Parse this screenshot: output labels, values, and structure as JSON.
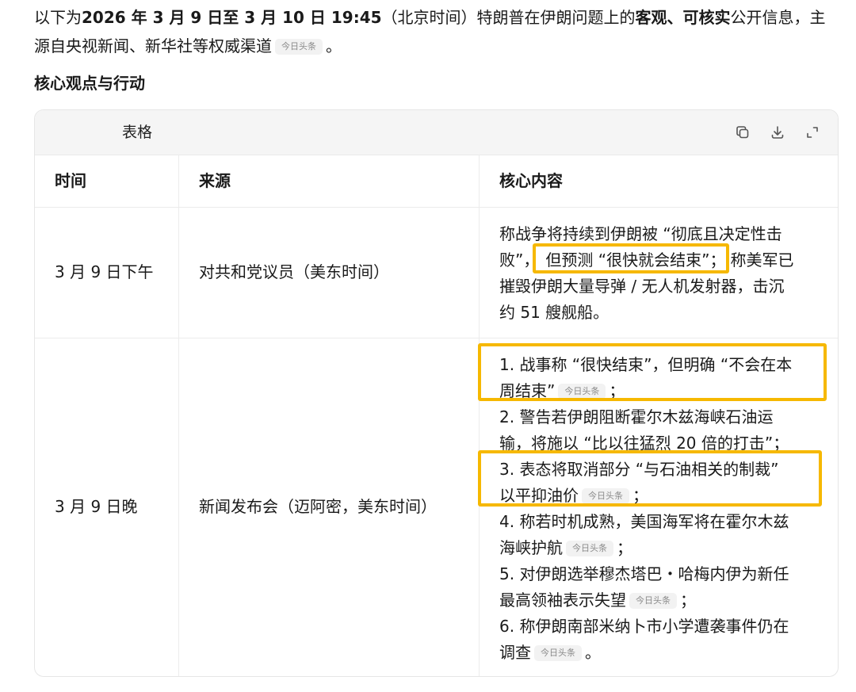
{
  "intro": {
    "l1_a": "以下为",
    "l1_b": "2026 年 3 月 9 日至 3 月 10 日 19:45",
    "l1_c": "（北京时间）特朗普在伊朗问题上的",
    "l1_d": "客观、可核实",
    "l1_e": "公开信息，主",
    "l2_a": "源自央视新闻、新华社等权威渠道",
    "l2_chip": "今日头条",
    "l2_b": "。"
  },
  "section_title": "核心观点与行动",
  "table": {
    "title": "表格",
    "icons": [
      "copy-icon",
      "download-icon",
      "expand-icon"
    ],
    "headers": {
      "time": "时间",
      "source": "来源",
      "content": "核心内容"
    },
    "rows": [
      {
        "time": "3 月 9 日下午",
        "source": "对共和党议员（美东时间）",
        "content_lines": [
          "称战争将持续到伊朗被 “彻底且决定性击",
          "败”，",
          "但预测 “很快就会结束”；",
          "称美军已",
          "摧毁伊朗大量导弹 / 无人机发射器，击沉",
          "约 51 艘舰船。"
        ]
      },
      {
        "time": "3 月 9 日晚",
        "source": "新闻发布会（迈阿密，美东时间）",
        "items": [
          {
            "l1": "1. 战事称 “很快结束”，但明确 “不会在本",
            "l2": "周结束”",
            "chip": "今日头条",
            "end": "；"
          },
          {
            "l1": "2. 警告若伊朗阻断霍尔木兹海峡石油运",
            "l2": "输，将施以 “比以往猛烈 20 倍的打击”；",
            "chip": "",
            "end": ""
          },
          {
            "l1": "3. 表态将取消部分 “与石油相关的制裁”",
            "l2": "以平抑油价",
            "chip": "今日头条",
            "end": "；"
          },
          {
            "l1": "4. 称若时机成熟，美国海军将在霍尔木兹",
            "l2": "海峡护航",
            "chip": "今日头条",
            "end": "；"
          },
          {
            "l1": "5. 对伊朗选举穆杰塔巴・哈梅内伊为新任",
            "l2": "最高领袖表示失望",
            "chip": "今日头条",
            "end": "；"
          },
          {
            "l1": "6. 称伊朗南部米纳卜市小学遭袭事件仍在",
            "l2": "调查",
            "chip": "今日头条",
            "end": "。"
          }
        ]
      }
    ]
  },
  "colors": {
    "highlight": "#f6b800",
    "chip_bg": "#f2f2f2",
    "chip_text": "#8a8a8a"
  }
}
